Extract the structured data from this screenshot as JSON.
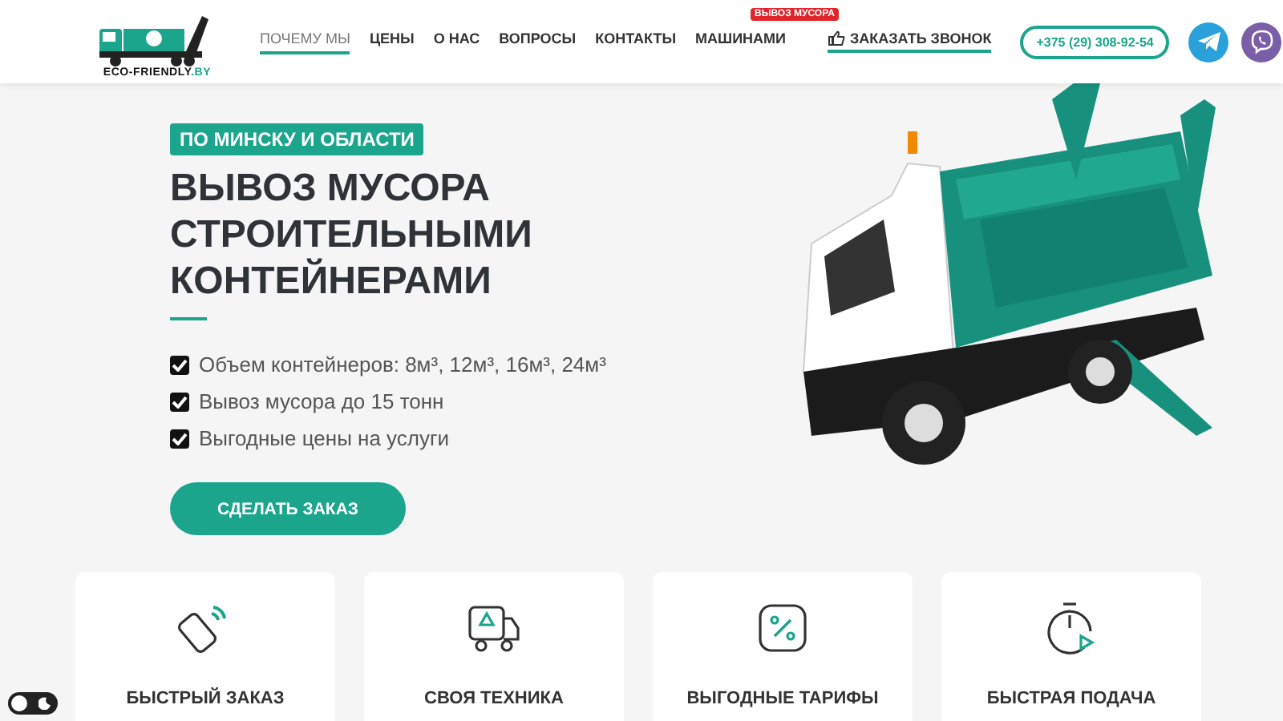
{
  "header": {
    "logo_text": "ECO-FRIENDLY",
    "logo_domain": ".BY",
    "nav": [
      {
        "label": "ПОЧЕМУ МЫ",
        "selected": true
      },
      {
        "label": "ЦЕНЫ",
        "selected": false
      },
      {
        "label": "О НАС",
        "selected": false
      },
      {
        "label": "ВОПРОСЫ",
        "selected": false
      },
      {
        "label": "КОНТАКТЫ",
        "selected": false
      },
      {
        "label": "МАШИНАМИ",
        "selected": false,
        "badge": "ВЫВОЗ МУСОРА"
      }
    ],
    "callback": "ЗАКАЗАТЬ ЗВОНОК",
    "phone": "+375 (29) 308-92-54"
  },
  "hero": {
    "tag": "ПО МИНСКУ И ОБЛАСТИ",
    "title": "ВЫВОЗ МУСОРА СТРОИТЕЛЬНЫМИ КОНТЕЙНЕРАМИ",
    "features": [
      {
        "text": "Объем контейнеров: 8м³, 12м³, 16м³, 24м³",
        "checked": true
      },
      {
        "text": "Вывоз мусора до 15 тонн",
        "checked": true
      },
      {
        "text": "Выгодные цены на услуги",
        "checked": true
      }
    ],
    "button": "СДЕЛАТЬ ЗАКАЗ"
  },
  "cards": [
    {
      "kind": "phone",
      "title": "БЫСТРЫЙ ЗАКАЗ"
    },
    {
      "kind": "truck",
      "title": "СВОЯ ТЕХНИКА"
    },
    {
      "kind": "percent",
      "title": "ВЫГОДНЫЕ ТАРИФЫ"
    },
    {
      "kind": "timer",
      "title": "БЫСТРАЯ ПОДАЧА"
    }
  ],
  "theme_toggle": {
    "on": false
  }
}
